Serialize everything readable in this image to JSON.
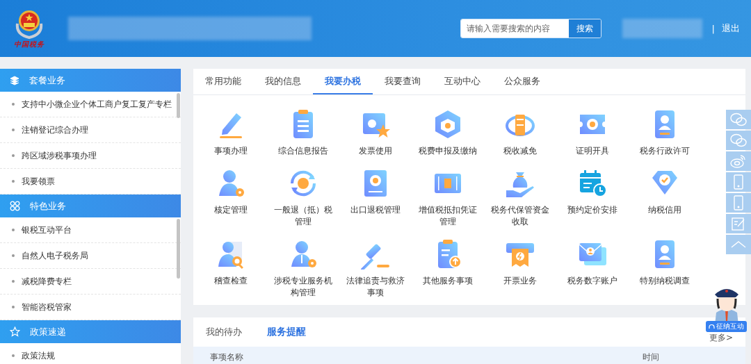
{
  "header": {
    "logo_caption": "中国税务",
    "search": {
      "placeholder": "请输入需要搜索的内容",
      "button": "搜索"
    },
    "separator": "|",
    "logout": "退出"
  },
  "sidebar": {
    "sections": [
      {
        "title": "套餐业务",
        "items": [
          {
            "label": "支持中小微企业个体工商户复工复产专栏"
          },
          {
            "label": "注销登记综合办理"
          },
          {
            "label": "跨区域涉税事项办理"
          },
          {
            "label": "我要领票"
          }
        ]
      },
      {
        "title": "特色业务",
        "items": [
          {
            "label": "银税互动平台"
          },
          {
            "label": "自然人电子税务局"
          },
          {
            "label": "减税降费专栏"
          },
          {
            "label": "智能咨税管家"
          }
        ]
      },
      {
        "title": "政策速递",
        "items": [
          {
            "label": "政策法规"
          }
        ]
      }
    ]
  },
  "main_tabs": [
    {
      "label": "常用功能",
      "selected": false
    },
    {
      "label": "我的信息",
      "selected": false
    },
    {
      "label": "我要办税",
      "selected": true
    },
    {
      "label": "我要查询",
      "selected": false
    },
    {
      "label": "互动中心",
      "selected": false
    },
    {
      "label": "公众服务",
      "selected": false
    }
  ],
  "services": [
    {
      "label": "事项办理"
    },
    {
      "label": "综合信息报告"
    },
    {
      "label": "发票使用"
    },
    {
      "label": "税费申报及缴纳"
    },
    {
      "label": "税收减免"
    },
    {
      "label": "证明开具"
    },
    {
      "label": "税务行政许可"
    },
    {
      "label": "核定管理"
    },
    {
      "label": "一般退（抵）税管理"
    },
    {
      "label": "出口退税管理"
    },
    {
      "label": "增值税抵扣凭证管理"
    },
    {
      "label": "税务代保管资金收取"
    },
    {
      "label": "预约定价安排"
    },
    {
      "label": "纳税信用"
    },
    {
      "label": "稽查检查"
    },
    {
      "label": "涉税专业服务机构管理"
    },
    {
      "label": "法律追责与救济事项"
    },
    {
      "label": "其他服务事项"
    },
    {
      "label": "开票业务"
    },
    {
      "label": "税务数字账户"
    },
    {
      "label": "特别纳税调查"
    }
  ],
  "todo": {
    "tabs": [
      {
        "label": "我的待办",
        "selected": false
      },
      {
        "label": "服务提醒",
        "selected": true
      }
    ],
    "more": "更多>",
    "columns": [
      "事项名称",
      "时间"
    ]
  },
  "assistant": {
    "badge": "征纳互动"
  }
}
